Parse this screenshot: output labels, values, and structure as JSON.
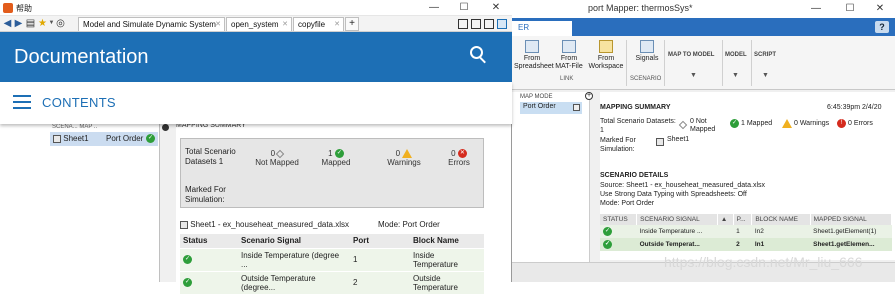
{
  "help_window": {
    "title": "帮助",
    "tabs": [
      {
        "label": "Model and Simulate Dynamic System"
      },
      {
        "label": "open_system"
      },
      {
        "label": "copyfile"
      }
    ],
    "new_tab": "+",
    "doc_title": "Documentation",
    "contents_label": "CONTENTS",
    "embedded": {
      "left_header": "SCENA... MAP ..",
      "left_row_name": "Sheet1",
      "left_row_mode": "Port Order",
      "summary_header": "MAPPING SUMMARY",
      "total_label": "Total Scenario Datasets 1",
      "stats": [
        {
          "count": "0",
          "label": "Not Mapped",
          "icon": "diamond-icon"
        },
        {
          "count": "1",
          "label": "Mapped",
          "icon": "check-icon"
        },
        {
          "count": "0",
          "label": "Warnings",
          "icon": "warning-icon"
        },
        {
          "count": "0",
          "label": "Errors",
          "icon": "error-icon"
        }
      ],
      "marked_label": "Marked For Simulation:",
      "file_label": "Sheet1 - ex_househeat_measured_data.xlsx",
      "mode_label": "Mode: Port Order",
      "columns": [
        "Status",
        "Scenario Signal",
        "Port",
        "Block Name"
      ],
      "rows": [
        {
          "signal": "Inside Temperature (degree ...",
          "port": "1",
          "block": "Inside Temperature"
        },
        {
          "signal": "Outside Temperature (degree...",
          "port": "2",
          "block": "Outside Temperature"
        }
      ]
    }
  },
  "bg_window": {
    "title": "port Mapper: thermosSys*",
    "tab": "ER",
    "help": "?",
    "ribbon": {
      "buttons": [
        {
          "label": "From Spreadsheet"
        },
        {
          "label": "From MAT-File"
        },
        {
          "label": "From Workspace"
        },
        {
          "label": "Signals"
        }
      ],
      "groups": [
        "LINK",
        "SCENARIO"
      ],
      "dropdowns": [
        "MAP TO MODEL",
        "MODEL",
        "SCRIPT"
      ]
    },
    "left": {
      "header": "MAP MODE",
      "row": "Port Order"
    },
    "summary": {
      "title": "MAPPING SUMMARY",
      "timestamp": "6:45:39pm 2/4/20",
      "total_label": "Total Scenario Datasets:",
      "total_value": "1",
      "not_mapped": "0 Not Mapped",
      "mapped": "1 Mapped",
      "warnings": "0 Warnings",
      "errors": "0 Errors",
      "marked_label": "Marked For Simulation:",
      "marked_value": "Sheet1"
    },
    "details": {
      "title": "SCENARIO DETAILS",
      "source": "Source: Sheet1 - ex_househeat_measured_data.xlsx",
      "typing": "Use Strong Data Typing with Spreadsheets: Off",
      "mode": "Mode: Port Order",
      "columns": [
        "STATUS",
        "SCENARIO SIGNAL",
        "▲",
        "P...",
        "BLOCK NAME",
        "MAPPED SIGNAL"
      ],
      "rows": [
        {
          "signal": "Inside Temperature ...",
          "port": "1",
          "block": "In2",
          "mapped": "Sheet1.getElement(1)"
        },
        {
          "signal": "Outside Temperat...",
          "port": "2",
          "block": "In1",
          "mapped": "Sheet1.getElemen..."
        }
      ]
    }
  },
  "watermark": "https://blog.csdn.net/Mr_liu_666",
  "colors": {
    "help_blue": "#1d6fb5",
    "ok_green": "#2e9e3a",
    "warn_yellow": "#f0b020",
    "err_red": "#d52b1e"
  }
}
